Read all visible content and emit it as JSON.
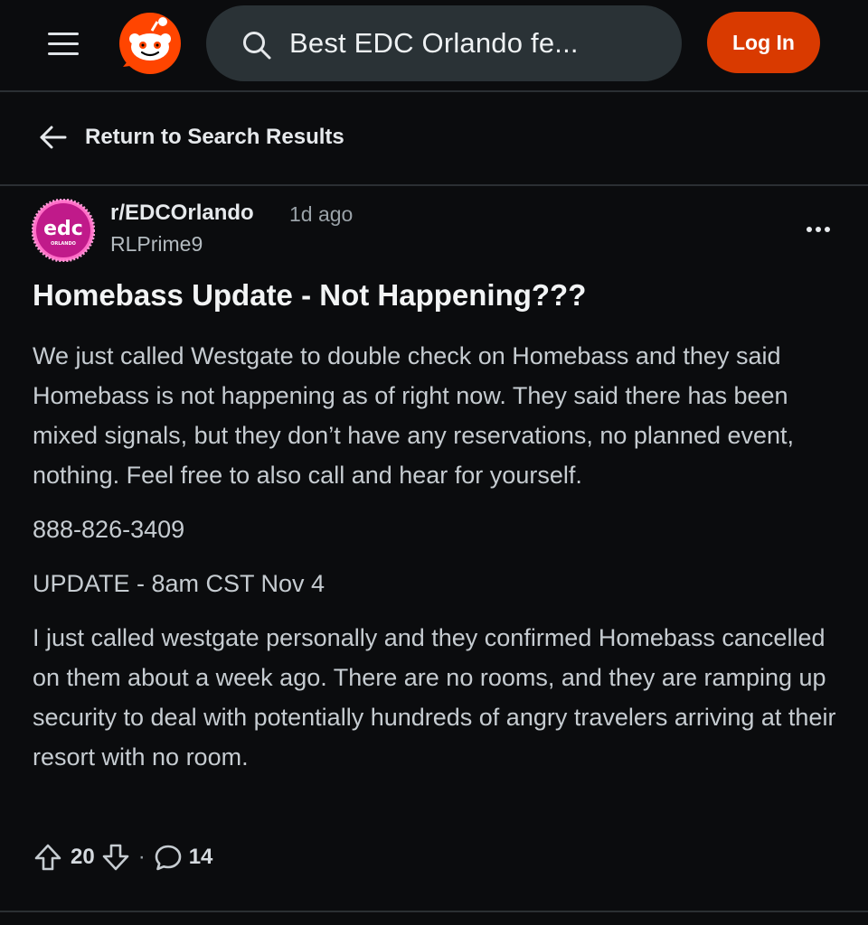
{
  "header": {
    "search_value": "Best EDC Orlando fe...",
    "login_label": "Log In"
  },
  "nav": {
    "return_label": "Return to Search Results"
  },
  "post": {
    "avatar_text": "edc",
    "avatar_subtext": "ORLANDO",
    "subreddit": "r/EDCOrlando",
    "time_ago": "1d ago",
    "author": "RLPrime9",
    "title": "Homebass Update - Not Happening???",
    "paragraphs": [
      "We just called Westgate to double check on Homebass and they said Homebass is not happening as of right now. They said there has been mixed signals, but they don’t have any reservations, no planned event, nothing. Feel free to also call and hear for yourself.",
      "888-826-3409",
      "UPDATE - 8am CST Nov 4",
      "I just called westgate personally and they confirmed Homebass cancelled on them about a week ago. There are no rooms, and they are ramping up security to deal with potentially hundreds of angry travelers arriving at their resort with no room."
    ],
    "upvotes": "20",
    "separator": "·",
    "comments": "14"
  },
  "colors": {
    "background": "#0b0c0e",
    "brand": "#ff4500",
    "login_button": "#d93a00",
    "search_field": "#2a3236",
    "avatar_pink": "#e0249a"
  },
  "icons": {
    "menu": "hamburger-icon",
    "logo": "reddit-logo",
    "search": "search-icon",
    "back": "arrow-left-icon",
    "more": "ellipsis-icon",
    "upvote": "arrow-up-icon",
    "downvote": "arrow-down-icon",
    "comment": "comment-bubble-icon"
  }
}
